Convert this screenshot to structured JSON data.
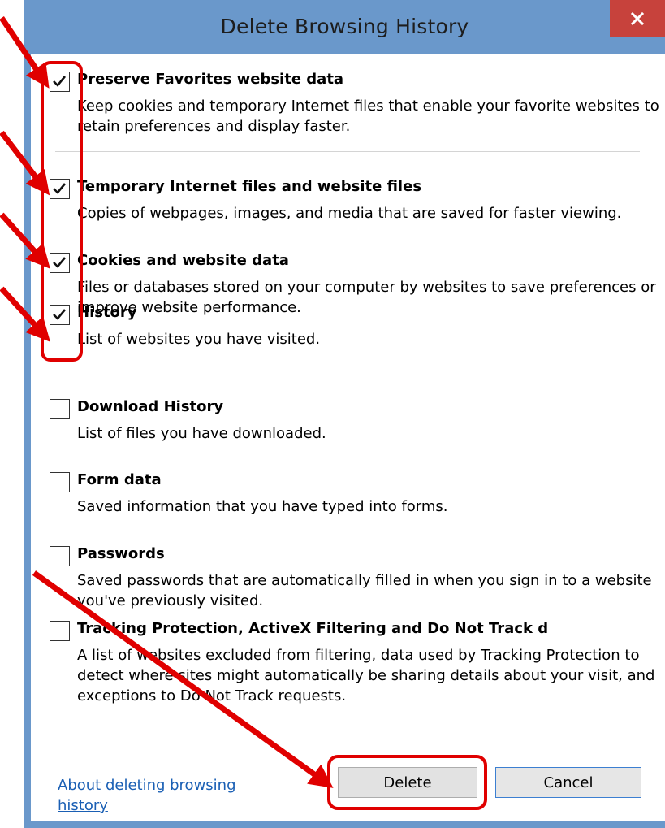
{
  "window": {
    "title": "Delete Browsing History",
    "close_icon": "close-icon"
  },
  "options": [
    {
      "title": "Preserve Favorites website data",
      "description": "Keep cookies and temporary Internet files that enable your favorite websites to retain preferences and display faster.",
      "checked": true
    },
    {
      "title": "Temporary Internet files and website files",
      "description": "Copies of webpages, images, and media that are saved for faster viewing.",
      "checked": true
    },
    {
      "title": "Cookies and website data",
      "description": "Files or databases stored on your computer by websites to save preferences or improve website performance.",
      "checked": true
    },
    {
      "title": "History",
      "description": "List of websites you have visited.",
      "checked": true
    },
    {
      "title": "Download History",
      "description": "List of files you have downloaded.",
      "checked": false
    },
    {
      "title": "Form data",
      "description": "Saved information that you have typed into forms.",
      "checked": false
    },
    {
      "title": "Passwords",
      "description": "Saved passwords that are automatically filled in when you sign in to a website you've previously visited.",
      "checked": false
    },
    {
      "title": "Tracking Protection, ActiveX Filtering and Do Not Track d",
      "description": "A list of websites excluded from filtering, data used by Tracking Protection to detect where sites might automatically be sharing details about your visit, and exceptions to Do Not Track requests.",
      "checked": false
    }
  ],
  "footer": {
    "about_link": "About deleting browsing history",
    "delete_label": "Delete",
    "cancel_label": "Cancel"
  },
  "annotations": {
    "highlight_color": "#e00000"
  }
}
